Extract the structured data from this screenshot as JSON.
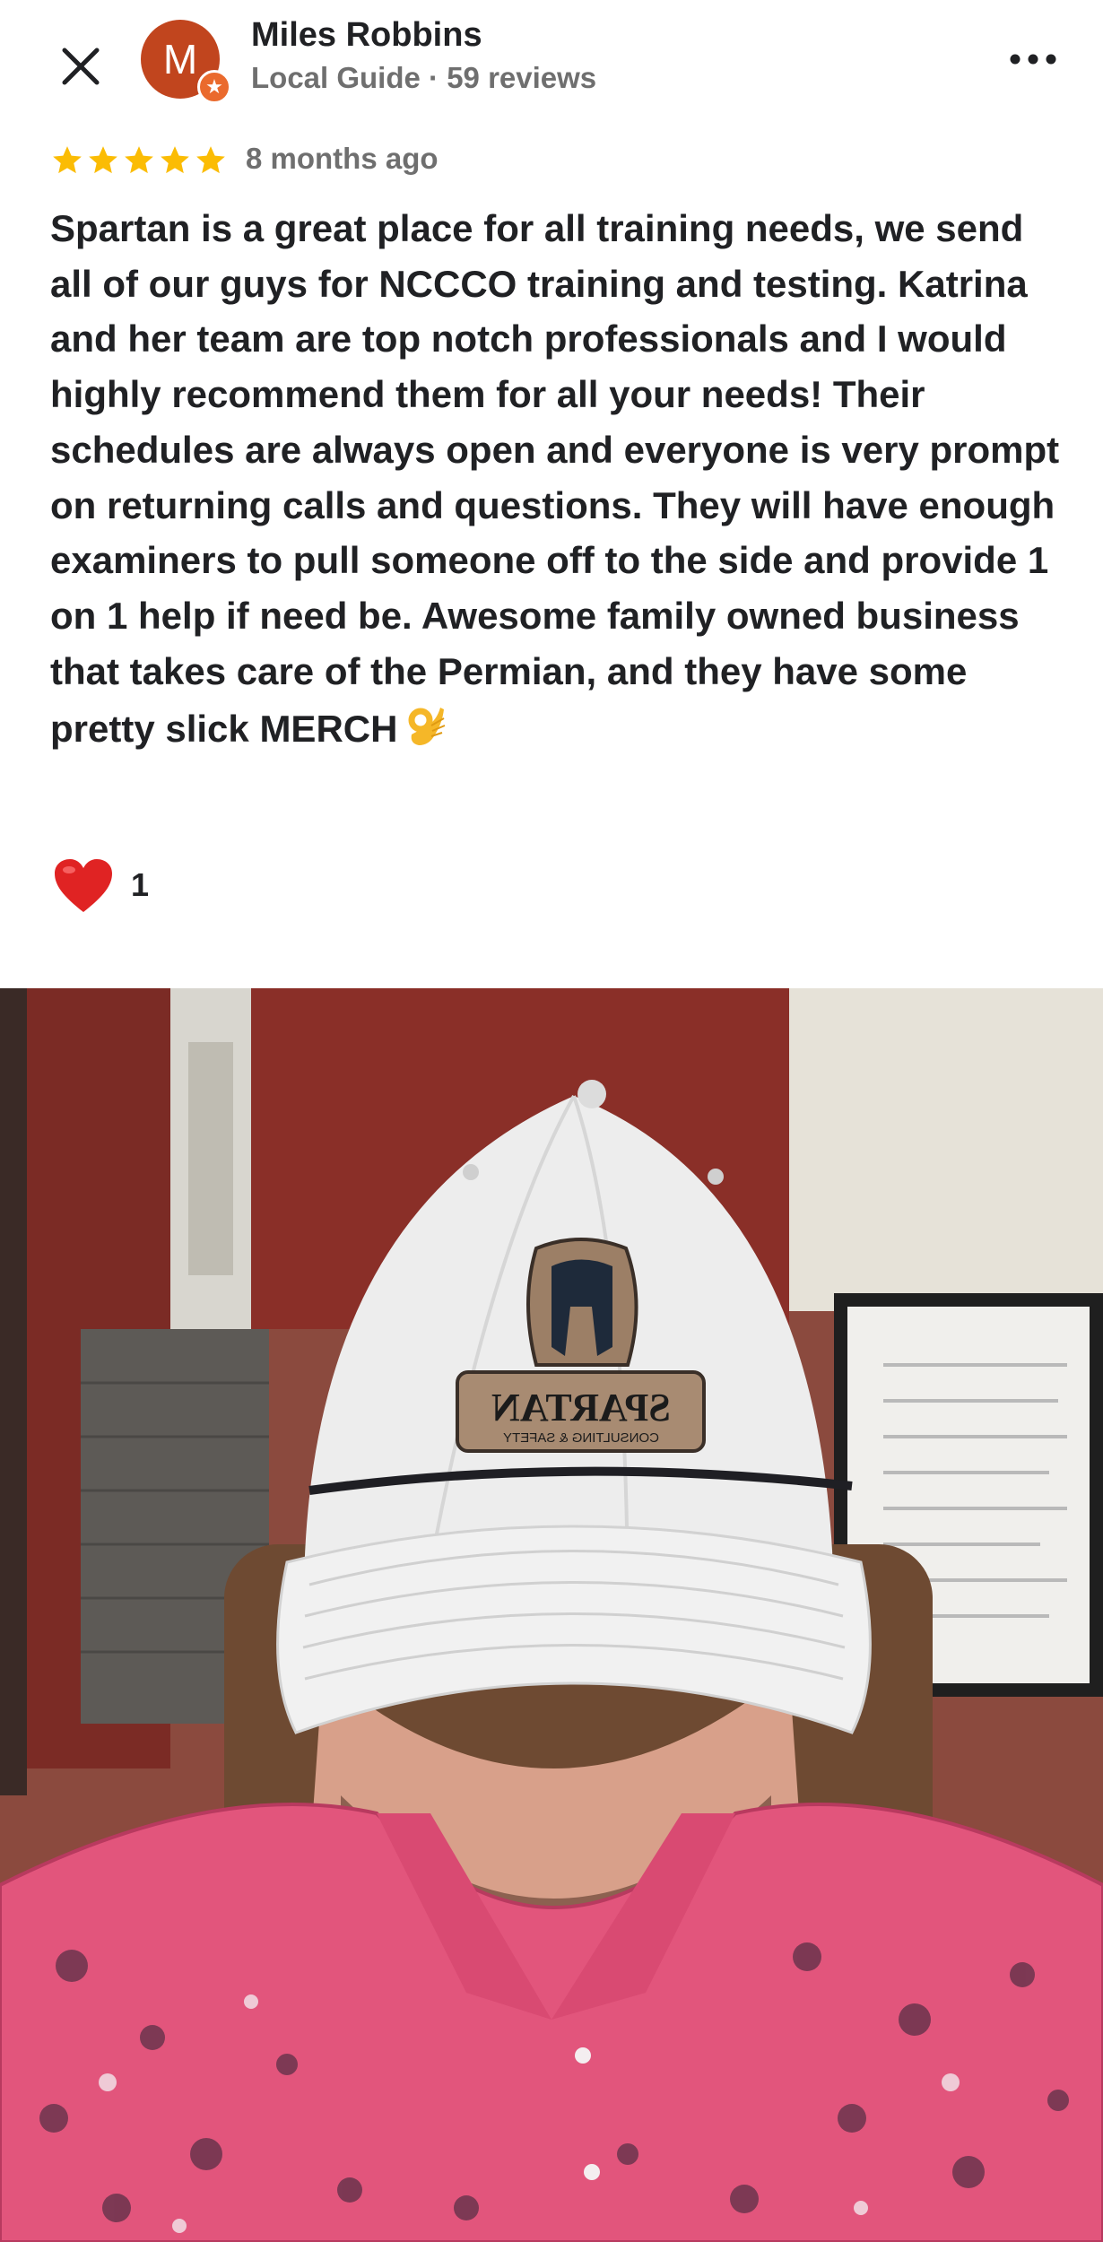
{
  "header": {
    "close_icon": "close-icon",
    "avatar_letter": "M",
    "avatar_color": "#c1451e",
    "badge_icon": "star-badge-icon",
    "reviewer_name": "Miles Robbins",
    "reviewer_meta": "Local Guide · 59 reviews",
    "more_icon": "more-horizontal-icon"
  },
  "rating": {
    "stars": 5,
    "star_color": "#fbbc04",
    "time_ago": "8 months ago"
  },
  "review": {
    "text": "Spartan is a great place for all training needs, we send all of our guys for NCCCO training and testing. Katrina and her team are top notch professionals and I would highly recommend them for all your needs!  Their schedules are always open and everyone is very prompt on returning calls and questions.  They will have enough examiners to pull someone off to the side and provide 1 on 1 help if need be.  Awesome family owned business that takes care of the Permian, and they have some pretty slick MERCH",
    "emoji": "ok-hand-emoji"
  },
  "reactions": {
    "heart_icon": "heart-icon",
    "count": "1"
  },
  "photo": {
    "description_icon": "review-photo",
    "hat_patch_text": "SPARTAN",
    "hat_patch_subtext": "CONSULTING & SAFETY",
    "shirt_color": "#e2557c",
    "hat_color": "#ededed"
  }
}
